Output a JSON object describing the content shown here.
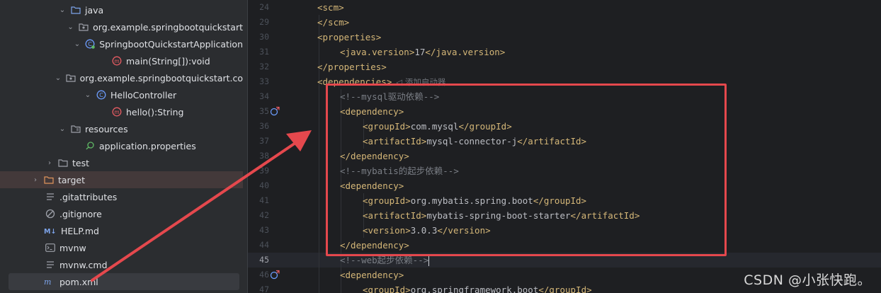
{
  "tree": {
    "rows": [
      {
        "label": "java",
        "icon": "folder-icon"
      },
      {
        "label": "org.example.springbootquickstart",
        "icon": "package-icon"
      },
      {
        "label": "SpringbootQuickstartApplication",
        "icon": "spring-class-icon"
      },
      {
        "label": "main(String[]):void",
        "icon": "method-icon"
      },
      {
        "label": "org.example.springbootquickstart.co",
        "icon": "package-icon"
      },
      {
        "label": "HelloController",
        "icon": "class-icon"
      },
      {
        "label": "hello():String",
        "icon": "method-icon"
      },
      {
        "label": "resources",
        "icon": "resources-folder-icon"
      },
      {
        "label": "application.properties",
        "icon": "properties-file-icon"
      },
      {
        "label": "test",
        "icon": "folder-icon"
      },
      {
        "label": "target",
        "icon": "excluded-folder-icon"
      },
      {
        "label": ".gitattributes",
        "icon": "text-file-icon"
      },
      {
        "label": ".gitignore",
        "icon": "gitignore-icon"
      },
      {
        "label": "HELP.md",
        "icon": "markdown-icon"
      },
      {
        "label": "mvnw",
        "icon": "shell-script-icon"
      },
      {
        "label": "mvnw.cmd",
        "icon": "text-file-icon"
      },
      {
        "label": "pom.xml",
        "icon": "maven-icon"
      }
    ]
  },
  "editor": {
    "line_numbers": [
      "24",
      "29",
      "30",
      "31",
      "32",
      "33",
      "34",
      "35",
      "36",
      "37",
      "38",
      "39",
      "40",
      "41",
      "42",
      "43",
      "44",
      "45",
      "46",
      "47"
    ],
    "inlay_hint": "添加启动器",
    "lines": [
      {
        "open": "<scm>"
      },
      {
        "open": "</scm>"
      },
      {
        "open": "<properties>"
      },
      {
        "open": "<java.version>",
        "text": "17",
        "close": "</java.version>"
      },
      {
        "open": "</properties>"
      },
      {
        "open": "<dependencies>"
      },
      {
        "comment": "<!--mysql驱动依赖-->"
      },
      {
        "open": "<dependency>"
      },
      {
        "open": "<groupId>",
        "text": "com.mysql",
        "close": "</groupId>"
      },
      {
        "open": "<artifactId>",
        "text": "mysql-connector-j",
        "close": "</artifactId>"
      },
      {
        "open": "</dependency>"
      },
      {
        "comment": "<!--mybatis的起步依赖-->"
      },
      {
        "open": "<dependency>"
      },
      {
        "open": "<groupId>",
        "text": "org.mybatis.spring.boot",
        "close": "</groupId>"
      },
      {
        "open": "<artifactId>",
        "text": "mybatis-spring-boot-starter",
        "close": "</artifactId>"
      },
      {
        "open": "<version>",
        "text": "3.0.3",
        "close": "</version>"
      },
      {
        "open": "</dependency>"
      },
      {
        "comment": "<!--web起步依赖-->"
      },
      {
        "open": "<dependency>"
      },
      {
        "open": "<groupId>",
        "text": "org.springframework.boot",
        "close": "</groupId>"
      }
    ]
  },
  "annotation": {
    "box_color": "#e5484d"
  },
  "watermark": "CSDN @小张快跑。"
}
